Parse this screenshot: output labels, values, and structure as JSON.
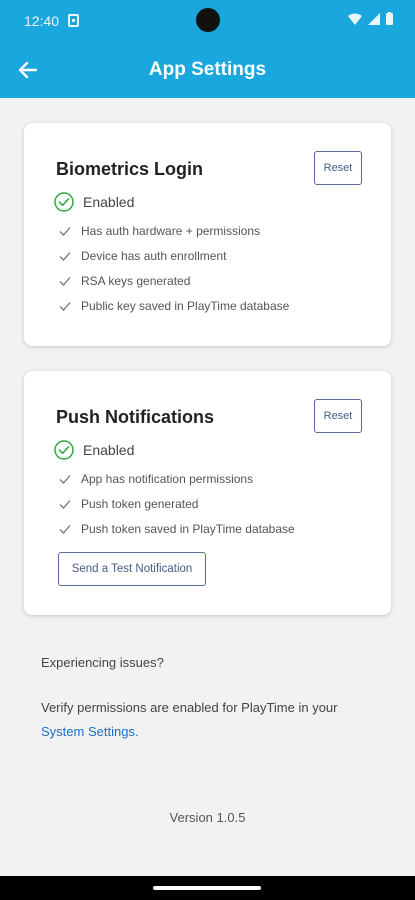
{
  "status_bar": {
    "time": "12:40"
  },
  "app_bar": {
    "title": "App Settings"
  },
  "biometrics": {
    "title": "Biometrics Login",
    "reset_label": "Reset",
    "status": "Enabled",
    "checks": [
      "Has auth hardware + permissions",
      "Device has auth enrollment",
      "RSA keys generated",
      "Public key saved in PlayTime database"
    ]
  },
  "push": {
    "title": "Push Notifications",
    "reset_label": "Reset",
    "status": "Enabled",
    "checks": [
      "App has notification permissions",
      "Push token generated",
      "Push token saved in PlayTime database"
    ],
    "test_button": "Send a Test Notification"
  },
  "help": {
    "issues": "Experiencing issues?",
    "verify": "Verify permissions are enabled for PlayTime in your",
    "link": "System Settings",
    "link_suffix": "."
  },
  "version": "Version 1.0.5",
  "colors": {
    "app_bar": "#1aa7dd",
    "success": "#2eaa3f",
    "link": "#1a6fc8",
    "outline_button": "#5a6a9c"
  }
}
